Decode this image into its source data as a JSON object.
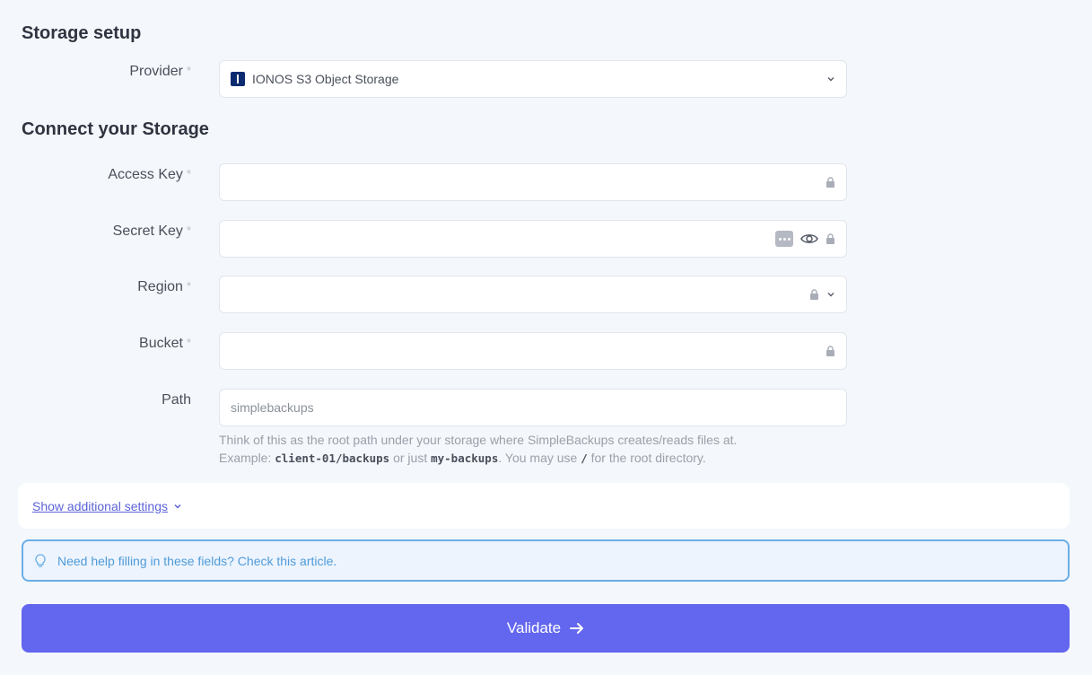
{
  "storage_setup": {
    "title": "Storage setup",
    "provider_label": "Provider",
    "provider_value": "IONOS S3 Object Storage",
    "required_mark": "*"
  },
  "connect": {
    "title": "Connect your Storage",
    "access_key_label": "Access Key",
    "access_key_value": "",
    "secret_key_label": "Secret Key",
    "secret_key_value": "",
    "region_label": "Region",
    "region_value": "",
    "bucket_label": "Bucket",
    "bucket_value": "",
    "path_label": "Path",
    "path_placeholder": "simplebackups",
    "path_hint_line1": "Think of this as the root path under your storage where SimpleBackups creates/reads files at.",
    "path_hint_example": "Example:",
    "path_hint_code1": "client-01/backups",
    "path_hint_or": "or just",
    "path_hint_code2": "my-backups",
    "path_hint_mid": ". You may use",
    "path_hint_code3": "/",
    "path_hint_end": "for the root directory."
  },
  "additional_settings": {
    "link_label": "Show additional settings"
  },
  "help": {
    "text": "Need help filling in these fields? Check this article."
  },
  "validate": {
    "label": "Validate"
  },
  "icons": {
    "provider": "ionos-logo-icon",
    "lock": "lock-icon",
    "eye": "eye-icon",
    "dots": "password-manager-icon",
    "chevron": "chevron-down-icon",
    "bulb": "lightbulb-icon",
    "arrow": "arrow-right-icon"
  },
  "colors": {
    "accent": "#6366ee",
    "help_border": "#6aaee6",
    "help_bg": "#edf4fe",
    "link": "#5b63d8",
    "provider_logo": "#0b2a6f"
  }
}
